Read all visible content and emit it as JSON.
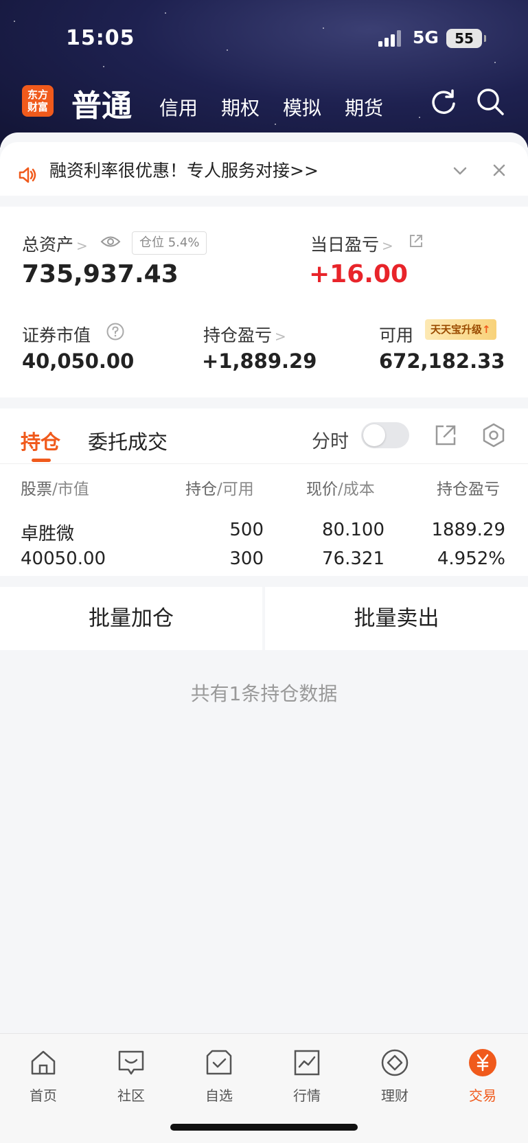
{
  "status": {
    "time": "15:05",
    "network": "5G",
    "battery": "55"
  },
  "header": {
    "logo_line1": "东方",
    "logo_line2": "财富",
    "main_tab": "普通",
    "tabs": [
      "信用",
      "期权",
      "模拟",
      "期货"
    ],
    "icons": [
      "refresh-icon",
      "search-icon"
    ]
  },
  "banner": {
    "text": "融资利率很优惠！专人服务对接>>"
  },
  "assets": {
    "total_label": "总资产",
    "position_ratio": "仓位 5.4%",
    "total_value": "735,937.43",
    "daily_pl_label": "当日盈亏",
    "daily_pl_value": "+16.00",
    "market_value_label": "证券市值",
    "market_value": "40,050.00",
    "holding_pl_label": "持仓盈亏",
    "holding_pl_value": "+1,889.29",
    "available_label": "可用",
    "available_value": "672,182.33",
    "upgrade_badge": "天天宝升级"
  },
  "positions": {
    "tabs": [
      "持仓",
      "委托成交"
    ],
    "timeshare_label": "分时",
    "columns": [
      {
        "main": "股票",
        "sub": "/市值"
      },
      {
        "main": "持仓",
        "sub": "/可用"
      },
      {
        "main": "现价",
        "sub": "/成本"
      },
      {
        "main": "持仓盈亏",
        "sub": ""
      }
    ],
    "rows": [
      {
        "name": "卓胜微",
        "market_value": "40050.00",
        "holding": "500",
        "available": "300",
        "price": "80.100",
        "cost": "76.321",
        "pl": "1889.29",
        "pl_pct": "4.952%"
      }
    ]
  },
  "actions": {
    "add": "批量加仓",
    "sell": "批量卖出"
  },
  "summary": "共有1条持仓数据",
  "bottom_nav": [
    {
      "label": "首页",
      "icon": "home-icon"
    },
    {
      "label": "社区",
      "icon": "chat-icon"
    },
    {
      "label": "自选",
      "icon": "watchlist-icon"
    },
    {
      "label": "行情",
      "icon": "chart-icon"
    },
    {
      "label": "理财",
      "icon": "diamond-icon"
    },
    {
      "label": "交易",
      "icon": "yuan-icon"
    }
  ],
  "colors": {
    "accent": "#f05a1c",
    "up": "#e8242a"
  }
}
